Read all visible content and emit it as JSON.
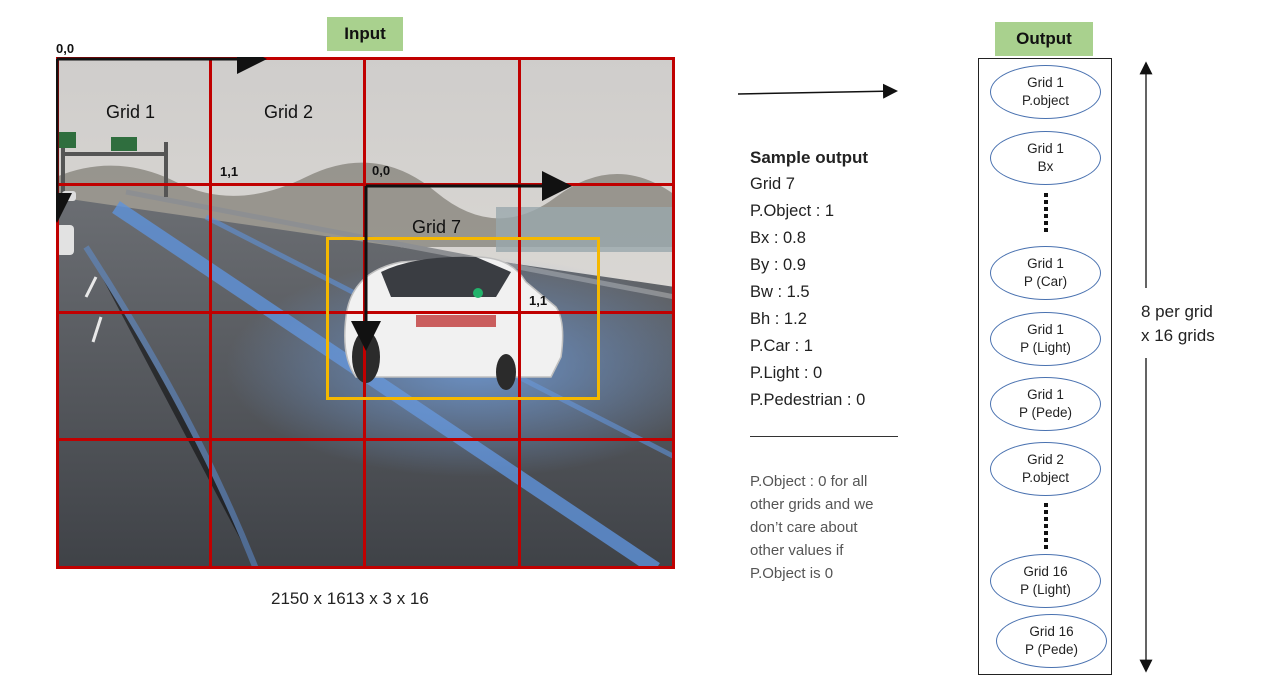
{
  "input_badge": "Input",
  "output_badge": "Output",
  "scene": {
    "origin_label": "0,0",
    "grid_labels": [
      "Grid 1",
      "Grid 2",
      "Grid 7"
    ],
    "cell_origin_label": "0,0",
    "cell_end_label_top": "1,1",
    "cell_end_label_right": "1,1",
    "dimensions": "2150 x 1613 x 3 x 16",
    "colors": {
      "grid": "#c00000",
      "bbox": "#f5b800",
      "center_dot": "#22b36b"
    }
  },
  "sample_output": {
    "title": "Sample output",
    "lines": [
      "Grid 7",
      "P.Object : 1",
      "Bx : 0.8",
      "By : 0.9",
      "Bw : 1.5",
      "Bh : 1.2",
      "P.Car : 1",
      "P.Light : 0",
      "P.Pedestrian : 0"
    ],
    "note_lines": [
      "P.Object : 0 for all",
      "other grids and we",
      "don’t care about",
      "other values if",
      "P.Object is 0"
    ]
  },
  "output_items": [
    {
      "line1": "Grid 1",
      "line2": "P.object"
    },
    {
      "line1": "Grid 1",
      "line2": "Bx"
    },
    {
      "line1": "Grid 1",
      "line2": "P (Car)"
    },
    {
      "line1": "Grid 1",
      "line2": "P (Light)"
    },
    {
      "line1": "Grid 1",
      "line2": "P (Pede)"
    },
    {
      "line1": "Grid 2",
      "line2": "P.object"
    },
    {
      "line1": "Grid 16",
      "line2": "P (Light)"
    },
    {
      "line1": "Grid 16",
      "line2": "P (Pede)"
    }
  ],
  "side_label": {
    "line1": "8 per grid",
    "line2": "x 16 grids"
  }
}
